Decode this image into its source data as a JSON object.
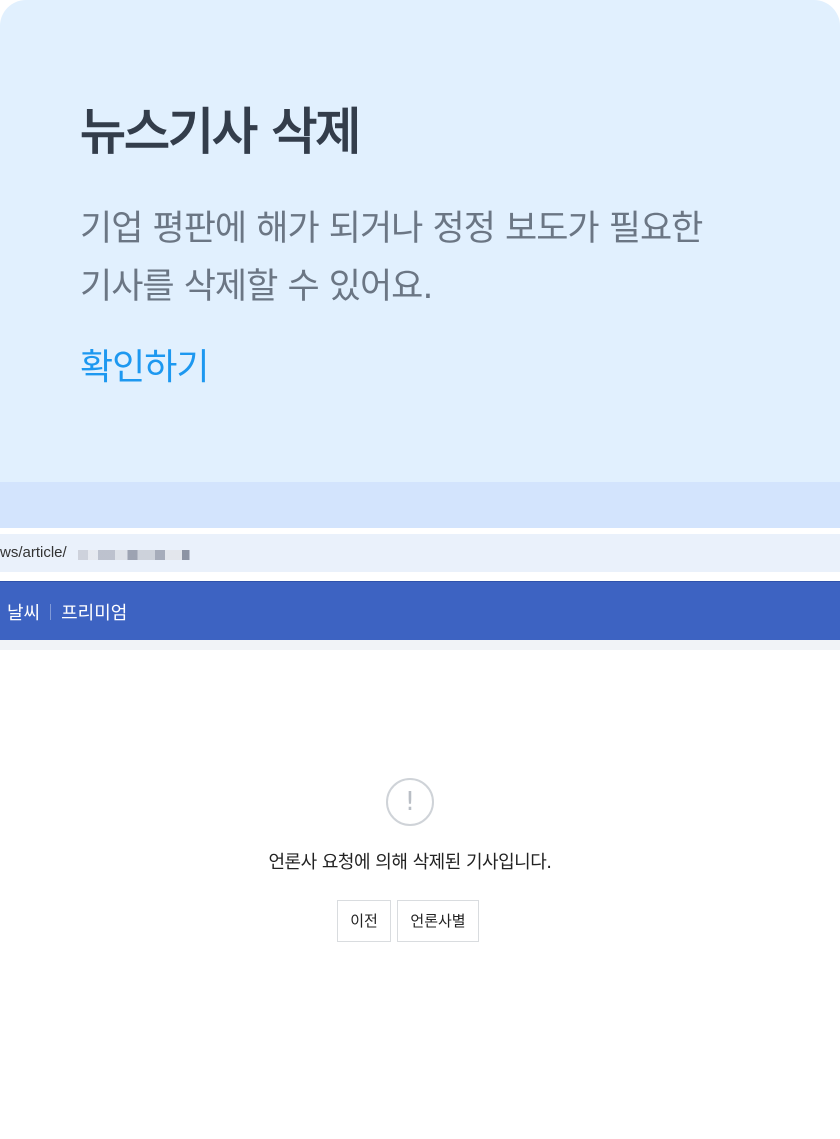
{
  "hero": {
    "title": "뉴스기사 삭제",
    "description_line1": "기업 평판에 해가 되거나 정정 보도가 필요한",
    "description_line2": "기사를 삭제할 수 있어요.",
    "link_label": "확인하기"
  },
  "browser": {
    "url_text": "ws/article/",
    "nav_items": [
      "날씨",
      "프리미엄"
    ],
    "notice": {
      "icon": "exclamation-circle-icon",
      "message": "언론사 요청에 의해 삭제된 기사입니다.",
      "prev_button": "이전",
      "press_button": "언론사별"
    }
  },
  "colors": {
    "hero_bg": "#e1f0fe",
    "accent_link": "#1d98f0",
    "navbar_bg": "#3d63c2"
  }
}
